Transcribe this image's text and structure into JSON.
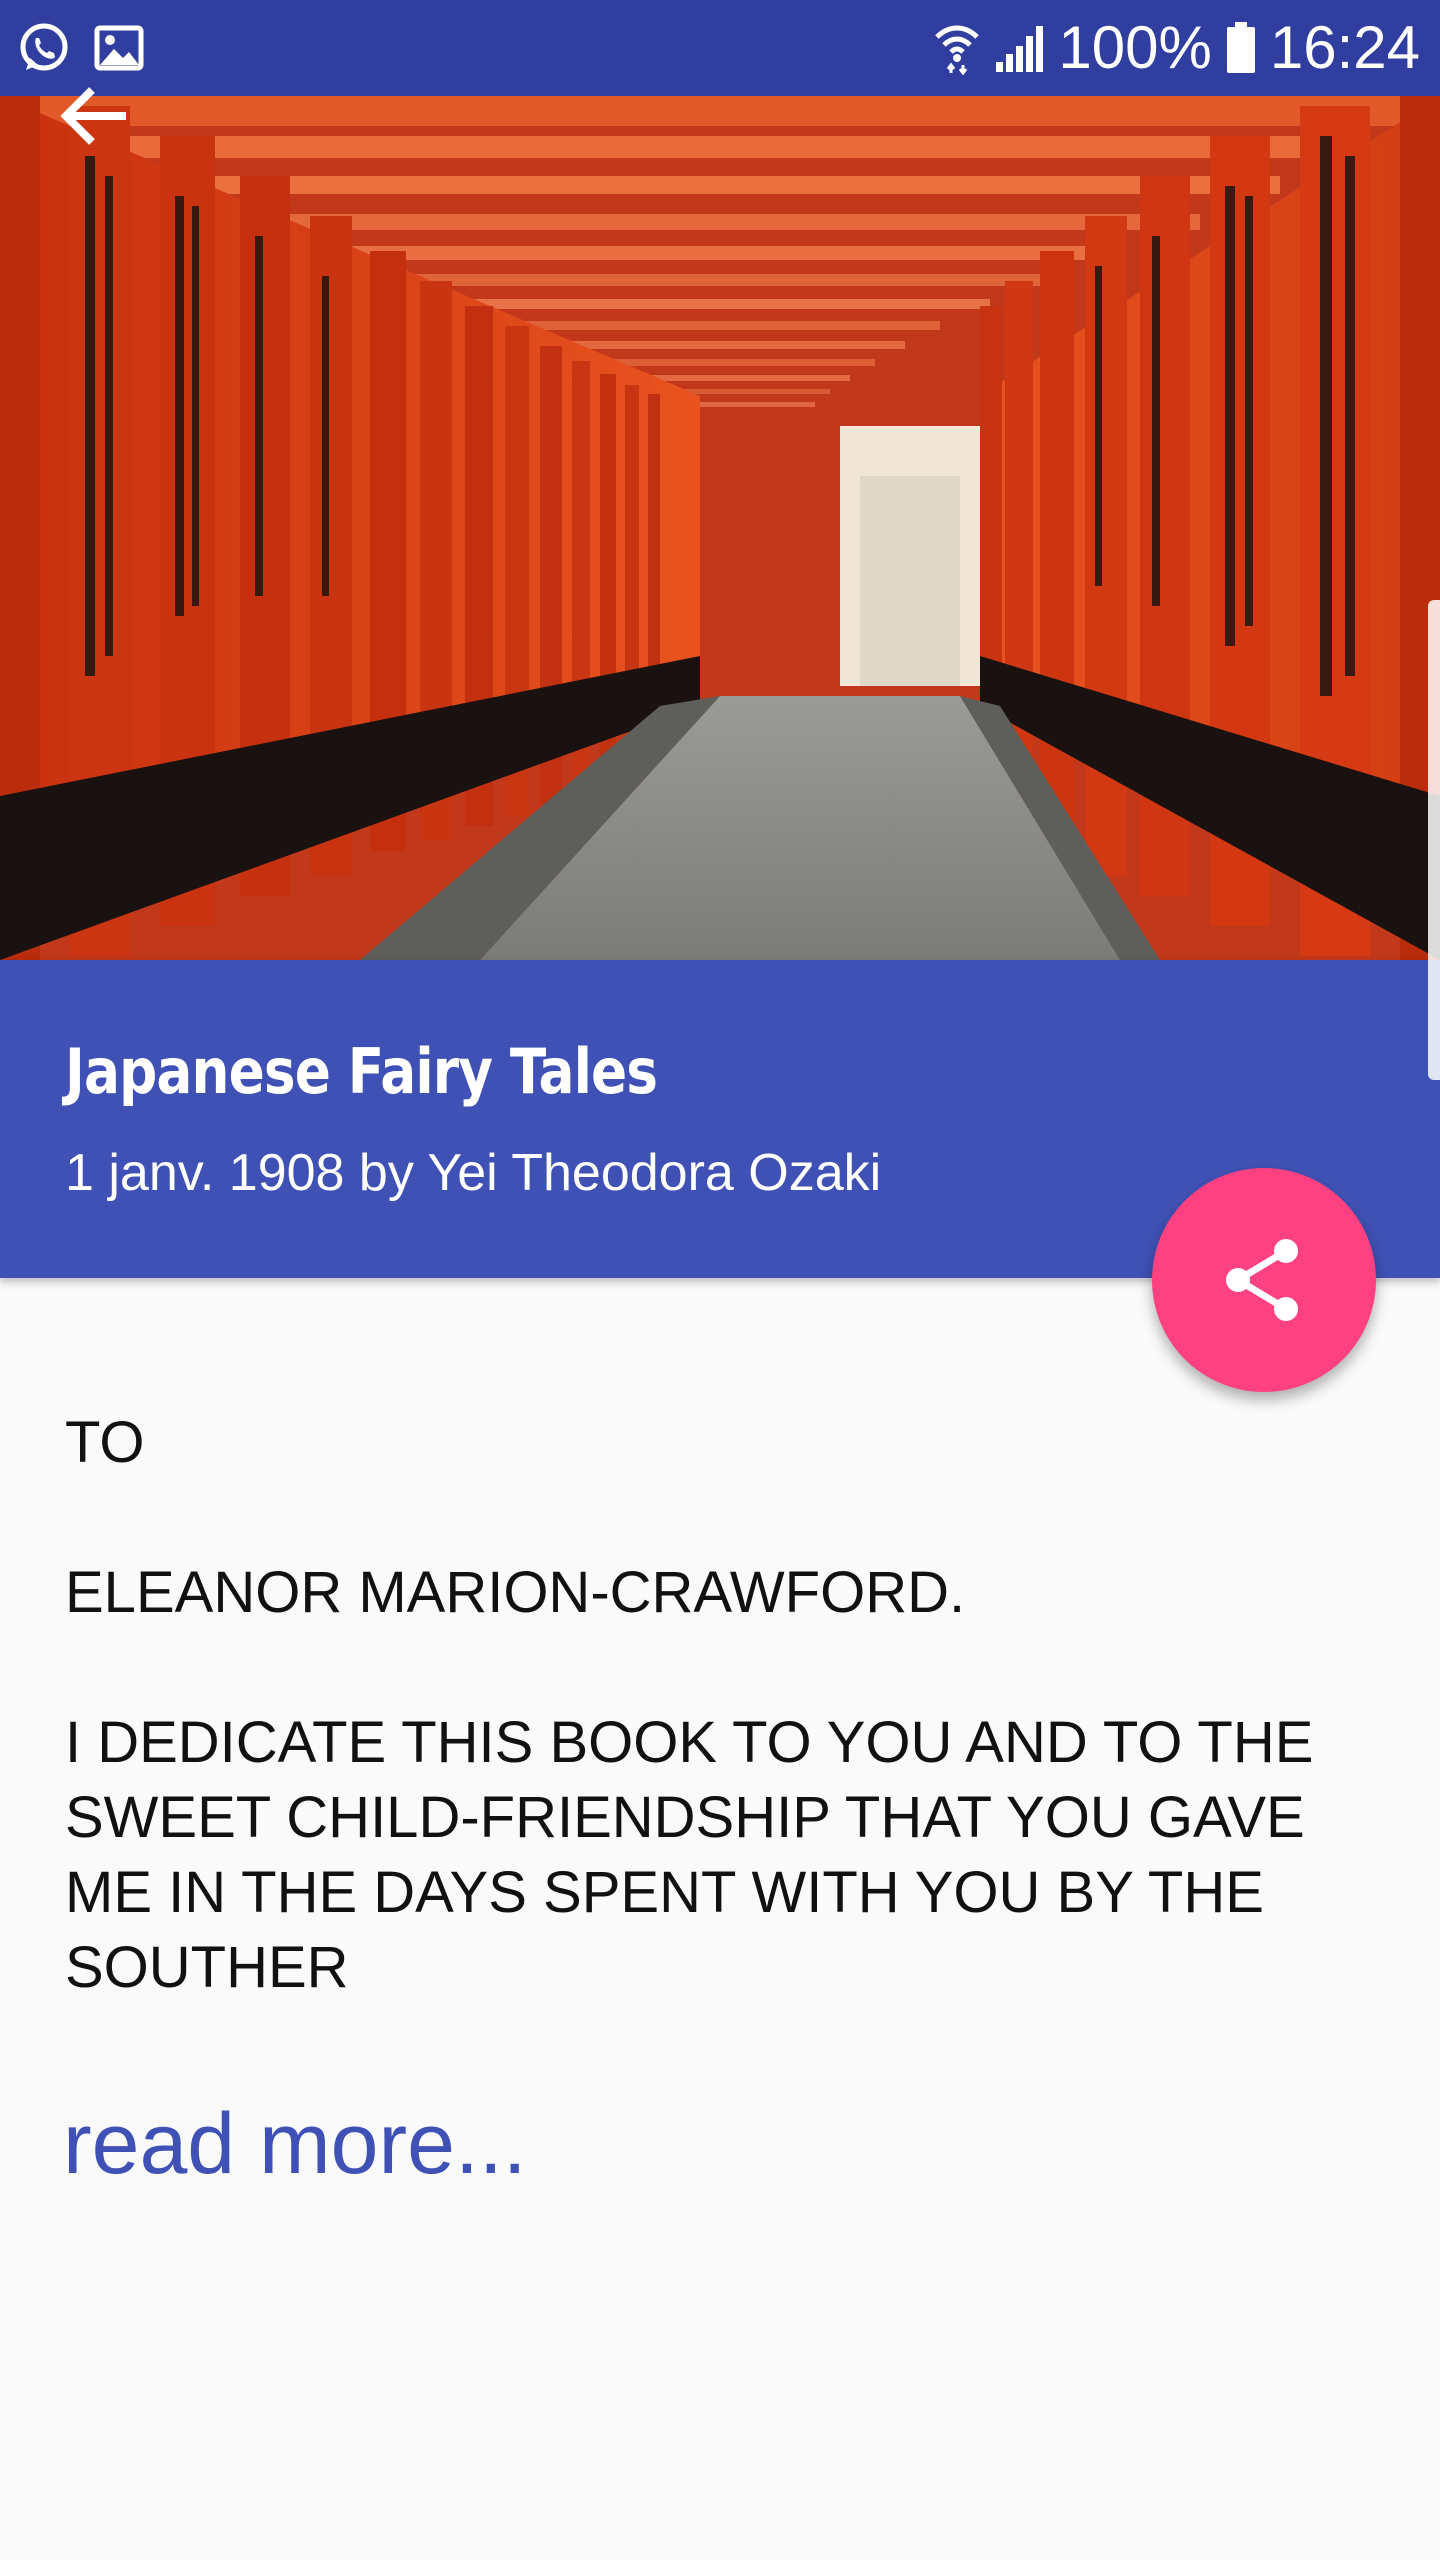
{
  "status_bar": {
    "battery_percent": "100%",
    "time": "16:24",
    "left_icons": [
      "whatsapp-icon",
      "gallery-icon"
    ],
    "right_icons": [
      "wifi-icon",
      "signal-icon",
      "battery-icon"
    ]
  },
  "toolbar": {
    "back_icon": "arrow-back-icon"
  },
  "hero": {
    "description_icon": "torii-gates-photo"
  },
  "book": {
    "title": "Japanese Fairy Tales",
    "meta": "1 janv. 1908 by Yei Theodora Ozaki"
  },
  "fab": {
    "icon": "share-icon"
  },
  "excerpt": {
    "text": "TO\n\nELEANOR MARION-CRAWFORD.\n\nI DEDICATE THIS BOOK TO YOU AND TO THE SWEET CHILD-FRIENDSHIP THAT YOU GAVE ME IN THE DAYS SPENT WITH YOU BY THE SOUTHER"
  },
  "read_more": {
    "label": "read more..."
  },
  "colors": {
    "status_bar": "#303f9f",
    "primary": "#3f51b5",
    "accent": "#ff4081",
    "background": "#fafafa",
    "torii_red": "#e8461c"
  }
}
